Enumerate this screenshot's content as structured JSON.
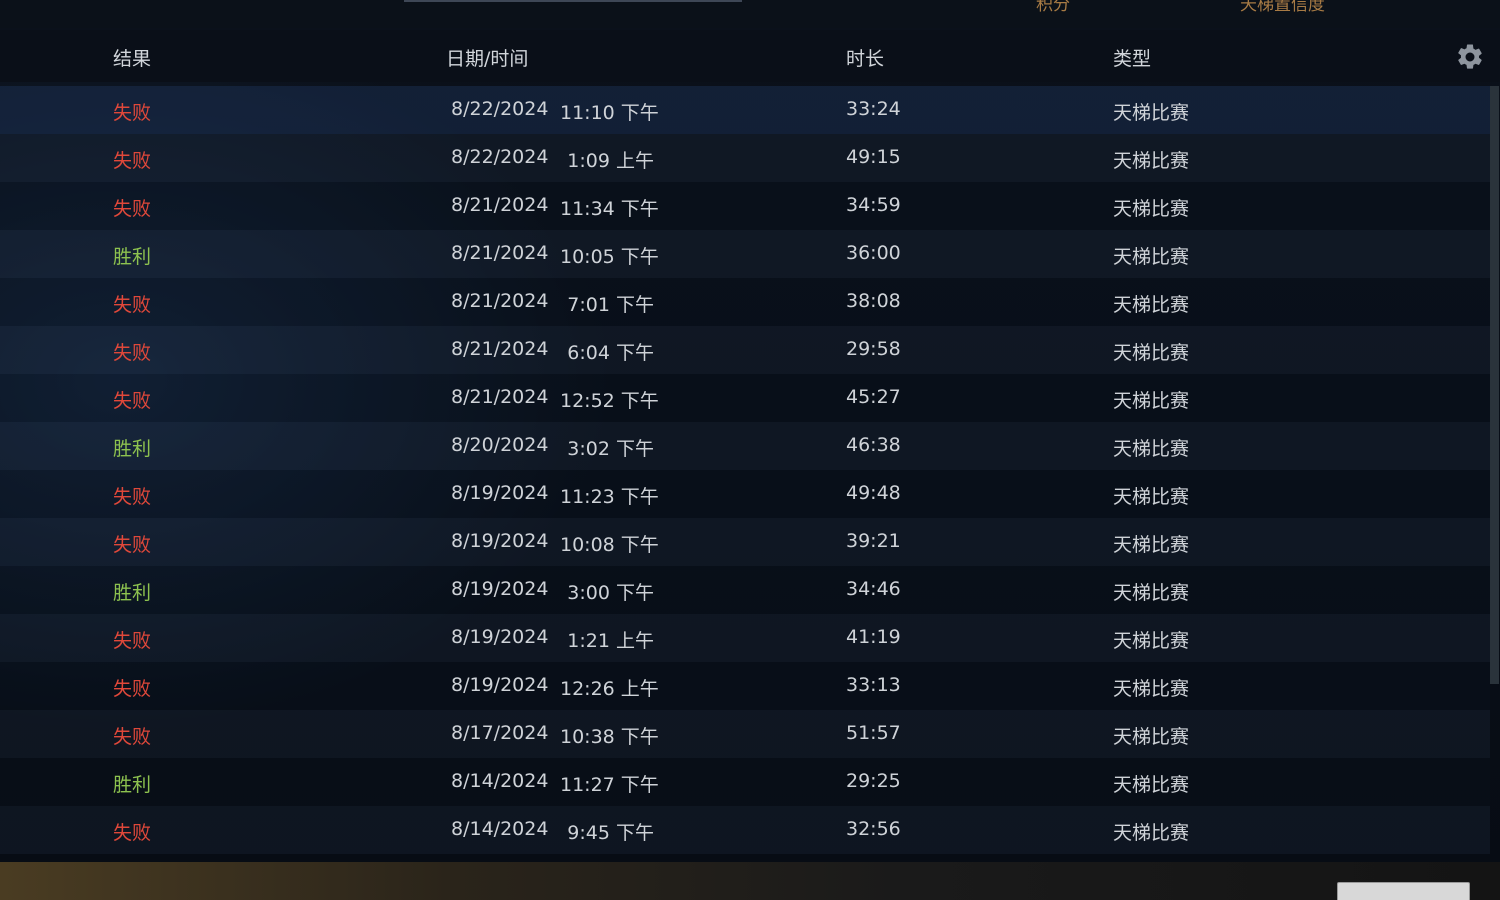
{
  "top_tabs": [
    {
      "label": "积分"
    },
    {
      "label": "天梯置信度"
    }
  ],
  "header": {
    "result": "结果",
    "datetime": "日期/时间",
    "duration": "时长",
    "type": "类型"
  },
  "icons": {
    "settings": "gear-icon"
  },
  "colors": {
    "loss": "#e0483a",
    "win": "#8dc24f",
    "top_tab": "#a87b45"
  },
  "rows": [
    {
      "result": "失败",
      "outcome": "loss",
      "date": "8/22/2024",
      "time": "11:10 下午",
      "duration": "33:24",
      "type": "天梯比赛"
    },
    {
      "result": "失败",
      "outcome": "loss",
      "date": "8/22/2024",
      "time": "1:09 上午",
      "duration": "49:15",
      "type": "天梯比赛"
    },
    {
      "result": "失败",
      "outcome": "loss",
      "date": "8/21/2024",
      "time": "11:34 下午",
      "duration": "34:59",
      "type": "天梯比赛"
    },
    {
      "result": "胜利",
      "outcome": "win",
      "date": "8/21/2024",
      "time": "10:05 下午",
      "duration": "36:00",
      "type": "天梯比赛"
    },
    {
      "result": "失败",
      "outcome": "loss",
      "date": "8/21/2024",
      "time": "7:01 下午",
      "duration": "38:08",
      "type": "天梯比赛"
    },
    {
      "result": "失败",
      "outcome": "loss",
      "date": "8/21/2024",
      "time": "6:04 下午",
      "duration": "29:58",
      "type": "天梯比赛"
    },
    {
      "result": "失败",
      "outcome": "loss",
      "date": "8/21/2024",
      "time": "12:52 下午",
      "duration": "45:27",
      "type": "天梯比赛"
    },
    {
      "result": "胜利",
      "outcome": "win",
      "date": "8/20/2024",
      "time": "3:02 下午",
      "duration": "46:38",
      "type": "天梯比赛"
    },
    {
      "result": "失败",
      "outcome": "loss",
      "date": "8/19/2024",
      "time": "11:23 下午",
      "duration": "49:48",
      "type": "天梯比赛"
    },
    {
      "result": "失败",
      "outcome": "loss",
      "date": "8/19/2024",
      "time": "10:08 下午",
      "duration": "39:21",
      "type": "天梯比赛"
    },
    {
      "result": "胜利",
      "outcome": "win",
      "date": "8/19/2024",
      "time": "3:00 下午",
      "duration": "34:46",
      "type": "天梯比赛"
    },
    {
      "result": "失败",
      "outcome": "loss",
      "date": "8/19/2024",
      "time": "1:21 上午",
      "duration": "41:19",
      "type": "天梯比赛"
    },
    {
      "result": "失败",
      "outcome": "loss",
      "date": "8/19/2024",
      "time": "12:26 上午",
      "duration": "33:13",
      "type": "天梯比赛"
    },
    {
      "result": "失败",
      "outcome": "loss",
      "date": "8/17/2024",
      "time": "10:38 下午",
      "duration": "51:57",
      "type": "天梯比赛"
    },
    {
      "result": "胜利",
      "outcome": "win",
      "date": "8/14/2024",
      "time": "11:27 下午",
      "duration": "29:25",
      "type": "天梯比赛"
    },
    {
      "result": "失败",
      "outcome": "loss",
      "date": "8/14/2024",
      "time": "9:45 下午",
      "duration": "32:56",
      "type": "天梯比赛"
    }
  ],
  "footer": {
    "text": "",
    "button_label": ""
  }
}
